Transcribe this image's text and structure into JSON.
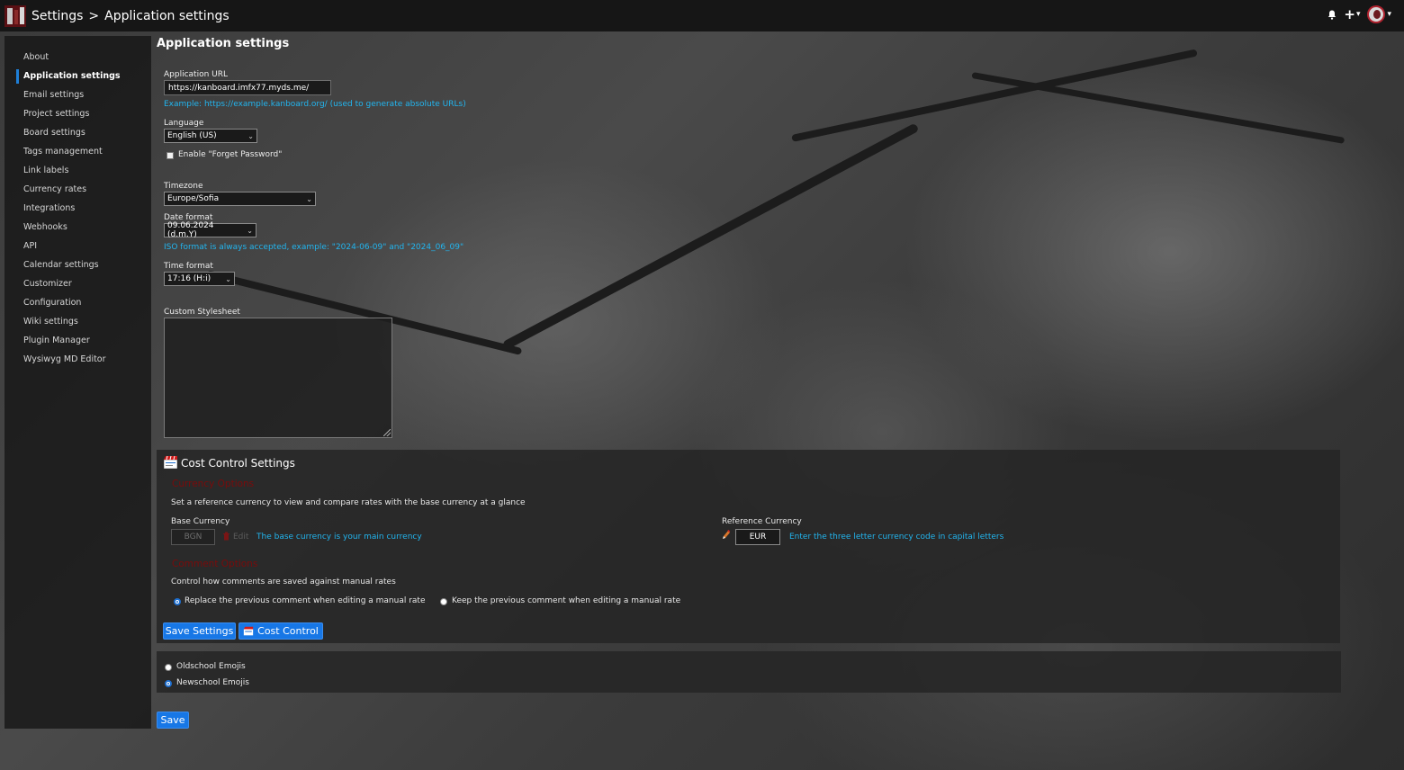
{
  "breadcrumb": {
    "root": "Settings",
    "separator": ">",
    "current": "Application settings"
  },
  "topbar": {
    "notifications_icon": "bell-icon",
    "add_icon": "plus-icon",
    "add_caret": "▾",
    "user_caret": "▾"
  },
  "sidebar": {
    "items": [
      {
        "label": "About"
      },
      {
        "label": "Application settings",
        "active": true
      },
      {
        "label": "Email settings"
      },
      {
        "label": "Project settings"
      },
      {
        "label": "Board settings"
      },
      {
        "label": "Tags management"
      },
      {
        "label": "Link labels"
      },
      {
        "label": "Currency rates"
      },
      {
        "label": "Integrations"
      },
      {
        "label": "Webhooks"
      },
      {
        "label": "API"
      },
      {
        "label": "Calendar settings"
      },
      {
        "label": "Customizer"
      },
      {
        "label": "Configuration"
      },
      {
        "label": "Wiki settings"
      },
      {
        "label": "Plugin Manager"
      },
      {
        "label": "Wysiwyg MD Editor"
      }
    ]
  },
  "page": {
    "title": "Application settings"
  },
  "form": {
    "app_url_label": "Application URL",
    "app_url_value": "https://kanboard.imfx77.myds.me/",
    "app_url_hint": "Example: https://example.kanboard.org/ (used to generate absolute URLs)",
    "language_label": "Language",
    "language_value": "English (US)",
    "forget_password_label": "Enable \"Forget Password\"",
    "forget_password_checked": false,
    "timezone_label": "Timezone",
    "timezone_value": "Europe/Sofia",
    "date_format_label": "Date format",
    "date_format_value": "09.06.2024 (d.m.Y)",
    "date_format_hint": "ISO format is always accepted, example: \"2024-06-09\" and \"2024_06_09\"",
    "time_format_label": "Time format",
    "time_format_value": "17:16 (H:i)",
    "custom_css_label": "Custom Stylesheet",
    "custom_css_value": ""
  },
  "cost_control": {
    "title": "Cost Control Settings",
    "currency_options_heading": "Currency Options",
    "currency_options_desc": "Set a reference currency to view and compare rates with the base currency at a glance",
    "base_currency_label": "Base Currency",
    "base_currency_value": "BGN",
    "edit_label": "Edit",
    "base_currency_hint": "The base currency is your main currency",
    "reference_currency_label": "Reference Currency",
    "reference_currency_value": "EUR",
    "reference_currency_hint": "Enter the three letter currency code in capital letters",
    "comment_options_heading": "Comment Options",
    "comment_options_desc": "Control how comments are saved against manual rates",
    "comment_replace_label": "Replace the previous comment when editing a manual rate",
    "comment_keep_label": "Keep the previous comment when editing a manual rate",
    "comment_mode_selected": "replace",
    "save_settings_label": "Save Settings",
    "cost_control_button_label": "Cost Control"
  },
  "emojis": {
    "oldschool_label": "Oldschool Emojis",
    "newschool_label": "Newschool Emojis",
    "selected": "newschool"
  },
  "save_label": "Save",
  "colors": {
    "accent": "#1777e6",
    "hint_text": "#22b5ef",
    "section_heading": "#7a0b0b",
    "topbar_bg": "#161616"
  }
}
